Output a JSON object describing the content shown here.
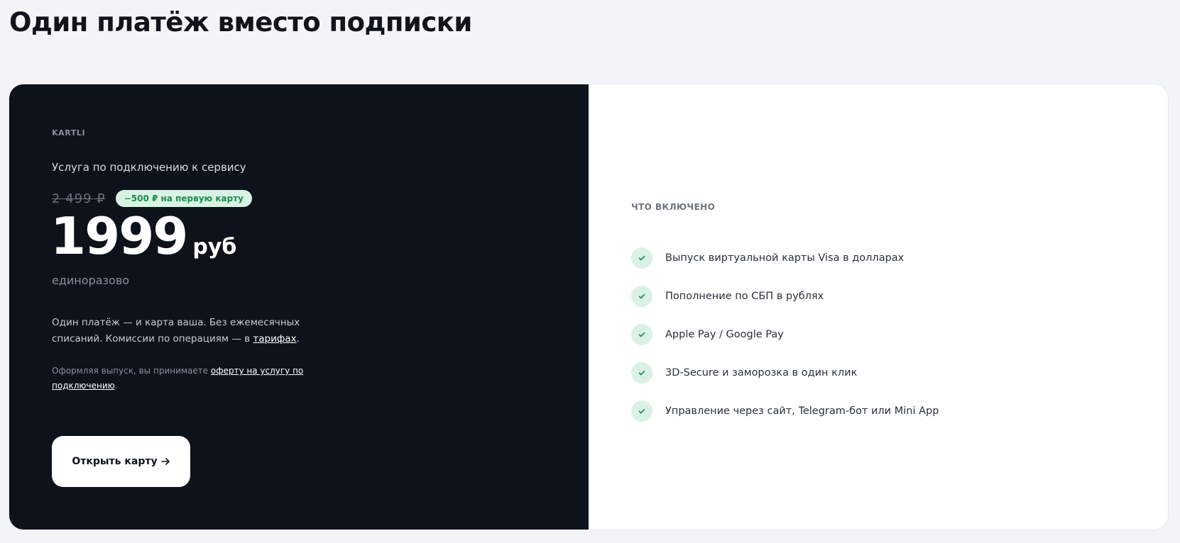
{
  "header": {
    "title": "Один платёж вместо подписки"
  },
  "offer_card": {
    "brand": "KARTLI",
    "service_name": "Услуга по подключению к сервису",
    "old_price": "2 499 ₽",
    "discount_badge": "−500 ₽ на первую карту",
    "price_value": "1999",
    "price_currency": "руб",
    "price_period": "единоразово",
    "description_prefix": "Один платёж — и карта ваша. Без ежемесячных списаний. Комиссии по операциям — в ",
    "description_link": "тарифах",
    "description_suffix": ".",
    "offer_prefix": "Оформляя выпуск, вы принимаете ",
    "offer_link": "оферту на услугу по подключению",
    "offer_suffix": ".",
    "cta_label": "Открыть карту",
    "cta_icon": "arrow-right-icon"
  },
  "included": {
    "title": "ЧТО ВКЛЮЧЕНО",
    "check_icon": "check-icon",
    "items": [
      {
        "label": "Выпуск виртуальной карты Visa в долларах"
      },
      {
        "label": "Пополнение по СБП в рублях"
      },
      {
        "label": "Apple Pay / Google Pay"
      },
      {
        "label": "3D-Secure и заморозка в один клик"
      },
      {
        "label": "Управление через сайт, Telegram-бот или Mini App"
      }
    ]
  },
  "colors": {
    "page_bg": "#f3f4f8",
    "dark_panel": "#0e121a",
    "accent_green": "#1f8a53",
    "badge_bg": "#d8f3e4"
  }
}
